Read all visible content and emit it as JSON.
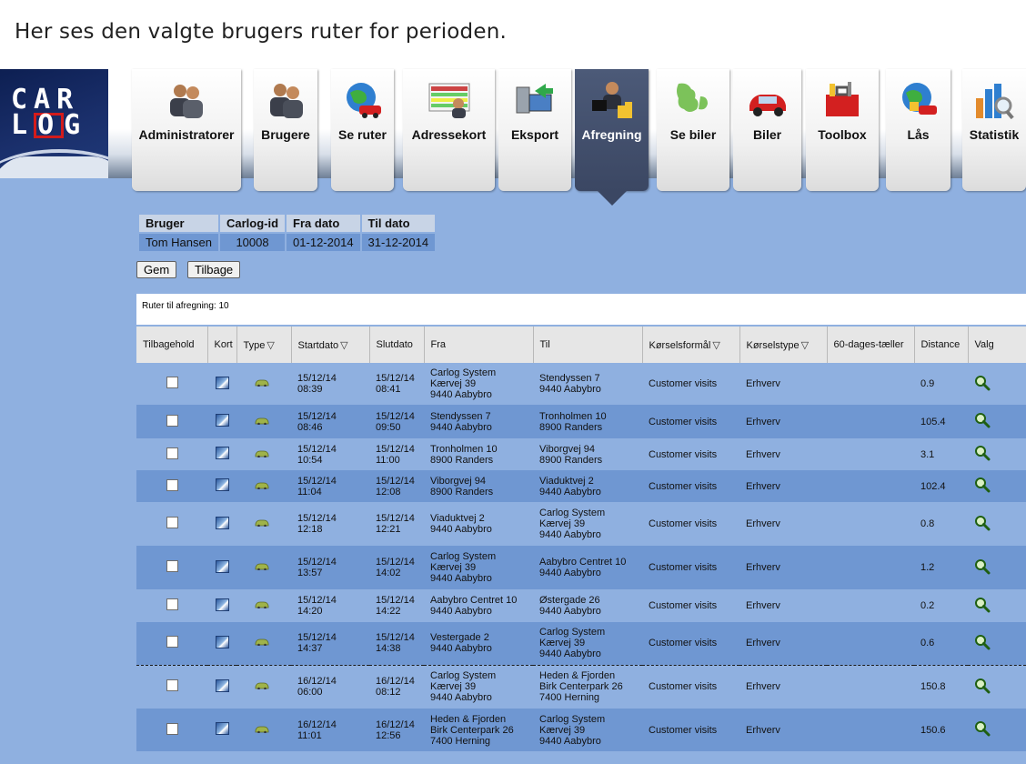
{
  "caption": "Her ses den valgte brugers ruter for perioden.",
  "logo": {
    "line1": "CAR",
    "line2_pre": "L",
    "line2_o": "O",
    "line2_post": "G"
  },
  "nav": [
    {
      "label": "Administratorer",
      "icon": "admin-users-icon"
    },
    {
      "label": "Brugere",
      "icon": "users-icon"
    },
    {
      "label": "Se ruter",
      "icon": "globe-car-icon"
    },
    {
      "label": "Adressekort",
      "icon": "address-card-icon"
    },
    {
      "label": "Eksport",
      "icon": "export-icon"
    },
    {
      "label": "Afregning",
      "icon": "billing-icon",
      "active": true
    },
    {
      "label": "Se biler",
      "icon": "map-denmark-icon"
    },
    {
      "label": "Biler",
      "icon": "red-car-icon"
    },
    {
      "label": "Toolbox",
      "icon": "toolbox-icon"
    },
    {
      "label": "Lås",
      "icon": "globe-lock-icon"
    },
    {
      "label": "Statistik",
      "icon": "bar-chart-icon"
    }
  ],
  "info": {
    "headers": [
      "Bruger",
      "Carlog-id",
      "Fra dato",
      "Til dato"
    ],
    "values": [
      "Tom Hansen",
      "10008",
      "01-12-2014",
      "31-12-2014"
    ]
  },
  "buttons": {
    "save": "Gem",
    "back": "Tilbage"
  },
  "routes_count": "Ruter til afregning: 10",
  "columns": [
    "Tilbagehold",
    "Kort",
    "Type",
    "Startdato",
    "Slutdato",
    "Fra",
    "Til",
    "Kørselsformål",
    "Kørselstype",
    "60-dages-tæller",
    "Distance",
    "Valg"
  ],
  "filter_symbol": "▽",
  "rows": [
    {
      "start": [
        "15/12/14",
        "08:39"
      ],
      "end": [
        "15/12/14",
        "08:41"
      ],
      "from": [
        "Carlog System",
        "Kærvej 39",
        "9440 Aabybro"
      ],
      "to": [
        "Stendyssen 7",
        "9440 Aabybro"
      ],
      "purpose": "Customer visits",
      "type": "Erhverv",
      "distance": "0.9"
    },
    {
      "start": [
        "15/12/14",
        "08:46"
      ],
      "end": [
        "15/12/14",
        "09:50"
      ],
      "from": [
        "Stendyssen 7",
        "9440 Aabybro"
      ],
      "to": [
        "Tronholmen 10",
        "8900 Randers"
      ],
      "purpose": "Customer visits",
      "type": "Erhverv",
      "distance": "105.4"
    },
    {
      "start": [
        "15/12/14",
        "10:54"
      ],
      "end": [
        "15/12/14",
        "11:00"
      ],
      "from": [
        "Tronholmen 10",
        "8900 Randers"
      ],
      "to": [
        "Viborgvej 94",
        "8900 Randers"
      ],
      "purpose": "Customer visits",
      "type": "Erhverv",
      "distance": "3.1"
    },
    {
      "start": [
        "15/12/14",
        "11:04"
      ],
      "end": [
        "15/12/14",
        "12:08"
      ],
      "from": [
        "Viborgvej 94",
        "8900 Randers"
      ],
      "to": [
        "Viaduktvej 2",
        "9440 Aabybro"
      ],
      "purpose": "Customer visits",
      "type": "Erhverv",
      "distance": "102.4"
    },
    {
      "start": [
        "15/12/14",
        "12:18"
      ],
      "end": [
        "15/12/14",
        "12:21"
      ],
      "from": [
        "Viaduktvej 2",
        "9440 Aabybro"
      ],
      "to": [
        "Carlog System",
        "Kærvej 39",
        "9440 Aabybro"
      ],
      "purpose": "Customer visits",
      "type": "Erhverv",
      "distance": "0.8"
    },
    {
      "start": [
        "15/12/14",
        "13:57"
      ],
      "end": [
        "15/12/14",
        "14:02"
      ],
      "from": [
        "Carlog System",
        "Kærvej 39",
        "9440 Aabybro"
      ],
      "to": [
        "Aabybro Centret 10",
        "9440 Aabybro"
      ],
      "purpose": "Customer visits",
      "type": "Erhverv",
      "distance": "1.2"
    },
    {
      "start": [
        "15/12/14",
        "14:20"
      ],
      "end": [
        "15/12/14",
        "14:22"
      ],
      "from": [
        "Aabybro Centret 10",
        "9440 Aabybro"
      ],
      "to": [
        "Østergade 26",
        "9440 Aabybro"
      ],
      "purpose": "Customer visits",
      "type": "Erhverv",
      "distance": "0.2"
    },
    {
      "start": [
        "15/12/14",
        "14:37"
      ],
      "end": [
        "15/12/14",
        "14:38"
      ],
      "from": [
        "Vestergade 2",
        "9440 Aabybro"
      ],
      "to": [
        "Carlog System",
        "Kærvej 39",
        "9440 Aabybro"
      ],
      "purpose": "Customer visits",
      "type": "Erhverv",
      "distance": "0.6"
    },
    {
      "start": [
        "16/12/14",
        "06:00"
      ],
      "end": [
        "16/12/14",
        "08:12"
      ],
      "from": [
        "Carlog System",
        "Kærvej 39",
        "9440 Aabybro"
      ],
      "to": [
        "Heden & Fjorden",
        "Birk Centerpark 26",
        "7400 Herning"
      ],
      "purpose": "Customer visits",
      "type": "Erhverv",
      "distance": "150.8",
      "day_break": true
    },
    {
      "start": [
        "16/12/14",
        "11:01"
      ],
      "end": [
        "16/12/14",
        "12:56"
      ],
      "from": [
        "Heden & Fjorden",
        "Birk Centerpark 26",
        "7400 Herning"
      ],
      "to": [
        "Carlog System",
        "Kærvej 39",
        "9440 Aabybro"
      ],
      "purpose": "Customer visits",
      "type": "Erhverv",
      "distance": "150.6"
    }
  ],
  "colors": {
    "page_bg": "#8fb0e0",
    "row_alt": "#6f97d2",
    "active_tab": "#3b4763",
    "logo_red": "#d31b1b"
  }
}
